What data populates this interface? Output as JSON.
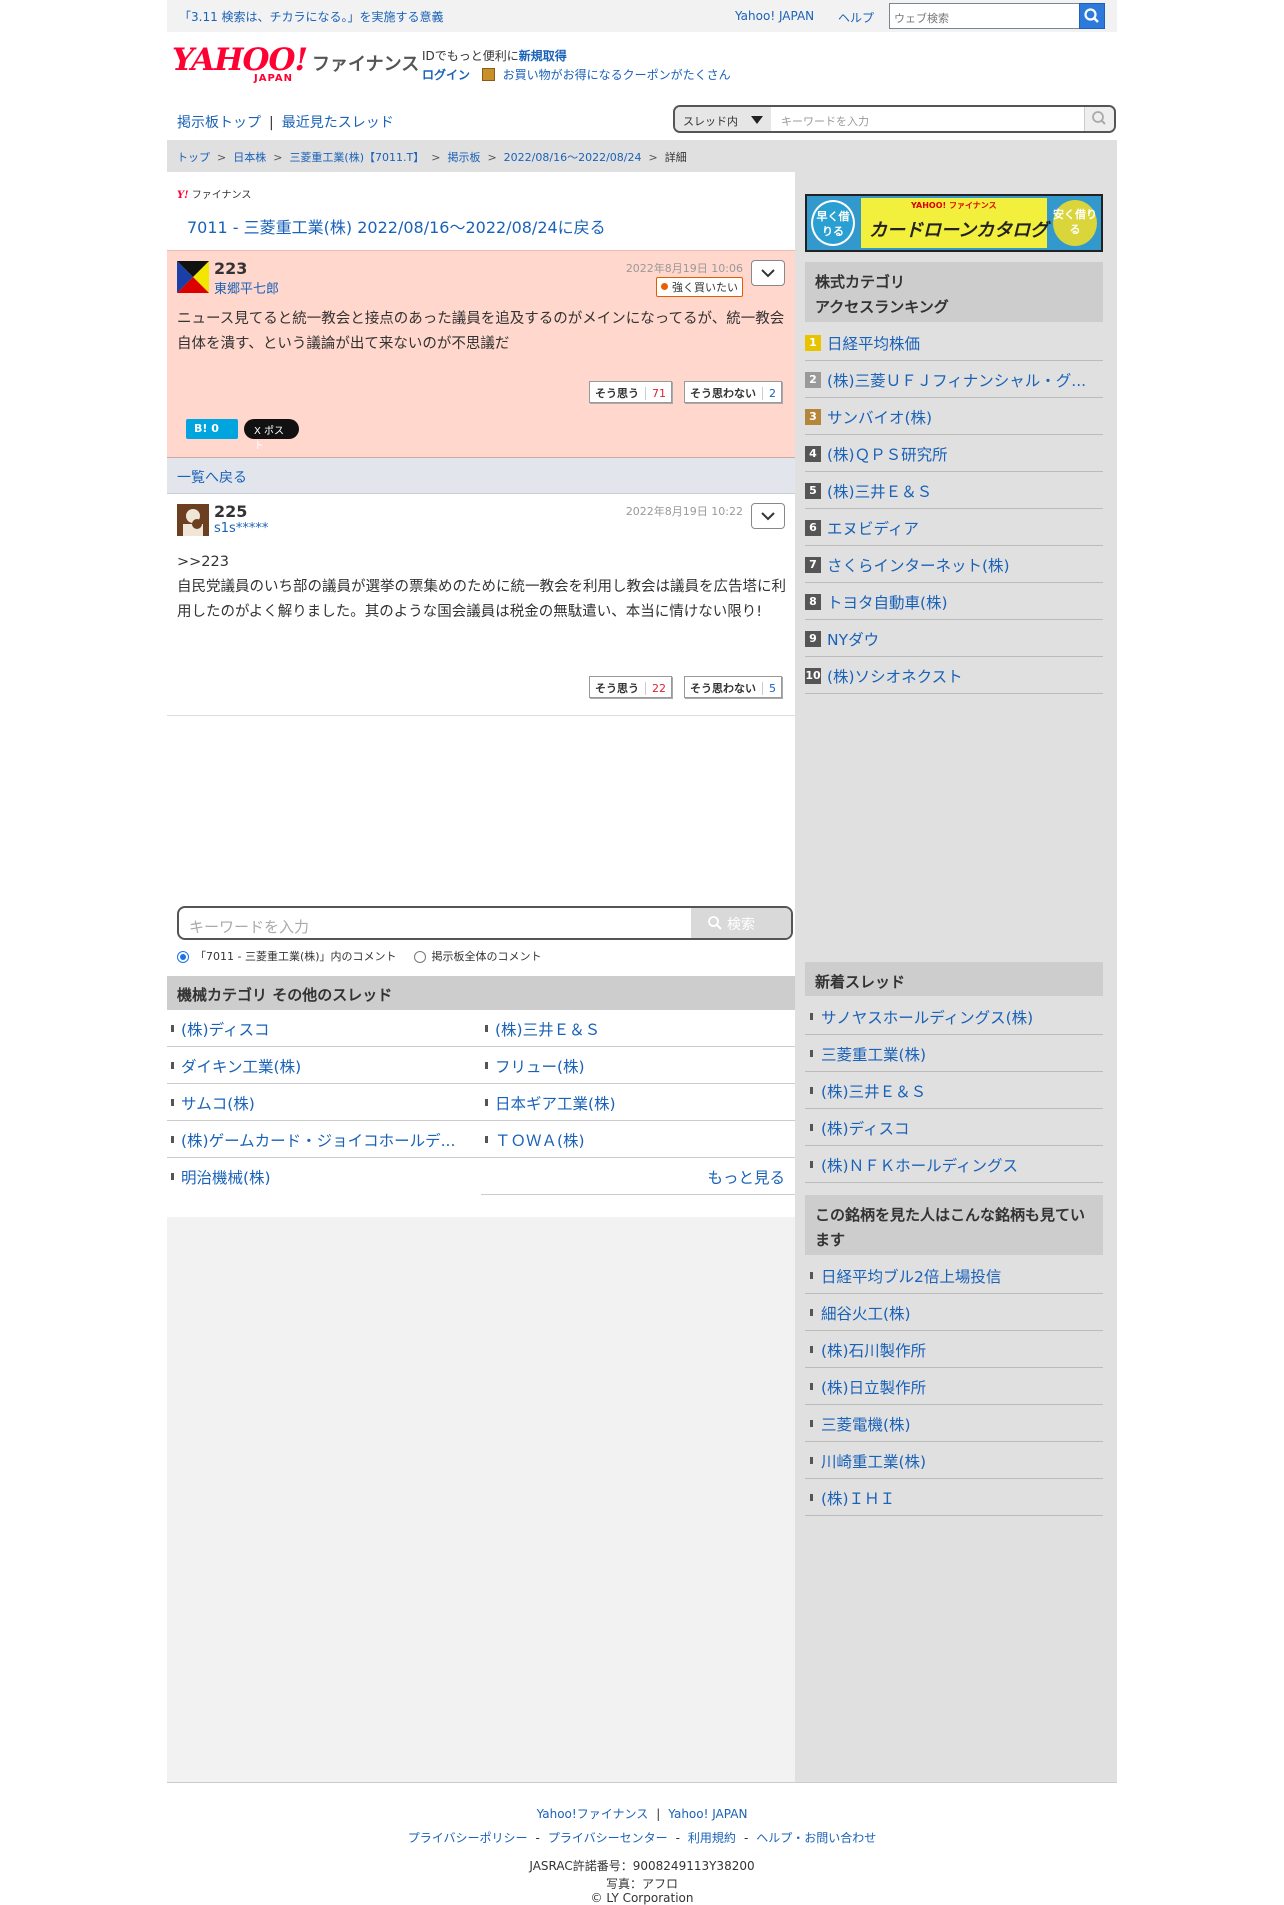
{
  "topbar": {
    "notice": "「3.11 検索は、チカラになる。」を実施する意義",
    "yahoo_japan": "Yahoo! JAPAN",
    "help": "ヘルプ",
    "web_search_placeholder": "ウェブ検索"
  },
  "logo": {
    "yahoo": "YAHOO!",
    "japan": "JAPAN",
    "service": "ファイナンス"
  },
  "id_area": {
    "line1_prefix": "IDでもっと便利に",
    "register": "新規取得",
    "login": "ログイン",
    "coupon": "お買い物がお得になるクーポンがたくさん"
  },
  "nav": {
    "board_top": "掲示板トップ",
    "recent_threads": "最近見たスレッド"
  },
  "thread_search": {
    "scope": "スレッド内",
    "placeholder": "キーワードを入力"
  },
  "breadcrumb": [
    "トップ",
    "日本株",
    "三菱重工業(株)【7011.T】",
    "掲示板",
    "2022/08/16〜2022/08/24",
    "詳細"
  ],
  "main": {
    "yf_brand": "ファイナンス",
    "back_link": "7011 - 三菱重工業(株) 2022/08/16〜2022/08/24に戻る",
    "back_to_list": "一覧へ戻る"
  },
  "posts": [
    {
      "number": "223",
      "author": "東郷平七郎",
      "date": "2022年8月19日 10:06",
      "sentiment": "強く買いたい",
      "text": "ニュース見てると統一教会と接点のあった議員を追及するのがメインになってるが、統一教会自体を潰す、という議論が出て来ないのが不思議だ",
      "agree_label": "そう思う",
      "agree_count": "71",
      "disagree_label": "そう思わない",
      "disagree_count": "2",
      "hatena": "B! 0",
      "tweet": "X ポスト"
    },
    {
      "number": "225",
      "author": "s1s*****",
      "date": "2022年8月19日 10:22",
      "text": ">>223\n自民党議員のいち部の議員が選挙の票集めのために統一教会を利用し教会は議員を広告塔に利用したのがよく解りました。其のような国会議員は税金の無駄遣い、本当に情けない限り!",
      "agree_label": "そう思う",
      "agree_count": "22",
      "disagree_label": "そう思わない",
      "disagree_count": "5"
    }
  ],
  "keyword_search": {
    "placeholder": "キーワードを入力",
    "button": "検索",
    "option_thread": "「7011 - 三菱重工業(株)」内のコメント",
    "option_all": "掲示板全体のコメント"
  },
  "other_threads": {
    "title": "機械カテゴリ その他のスレッド",
    "items": [
      "(株)ディスコ",
      "(株)三井Ｅ＆Ｓ",
      "ダイキン工業(株)",
      "フリュー(株)",
      "サムコ(株)",
      "日本ギア工業(株)",
      "(株)ゲームカード・ジョイコホールデ...",
      "ＴＯＷＡ(株)",
      "明治機械(株)"
    ],
    "more": "もっと見る"
  },
  "ad": {
    "left": "早く借りる",
    "brand": "YAHOO! ファイナンス",
    "title": "カードローンカタログ",
    "right": "安く借りる"
  },
  "ranking": {
    "title": "株式カテゴリ\nアクセスランキング",
    "items": [
      {
        "rank": "1",
        "name": "日経平均株価"
      },
      {
        "rank": "2",
        "name": "(株)三菱ＵＦＪフィナンシャル・グ..."
      },
      {
        "rank": "3",
        "name": "サンバイオ(株)"
      },
      {
        "rank": "4",
        "name": "(株)ＱＰＳ研究所"
      },
      {
        "rank": "5",
        "name": "(株)三井Ｅ＆Ｓ"
      },
      {
        "rank": "6",
        "name": "エヌビディア"
      },
      {
        "rank": "7",
        "name": "さくらインターネット(株)"
      },
      {
        "rank": "8",
        "name": "トヨタ自動車(株)"
      },
      {
        "rank": "9",
        "name": "NYダウ"
      },
      {
        "rank": "10",
        "name": "(株)ソシオネクスト"
      }
    ]
  },
  "new_threads": {
    "title": "新着スレッド",
    "items": [
      "サノヤスホールディングス(株)",
      "三菱重工業(株)",
      "(株)三井Ｅ＆Ｓ",
      "(株)ディスコ",
      "(株)ＮＦＫホールディングス"
    ]
  },
  "also_viewed": {
    "title": "この銘柄を見た人はこんな銘柄も見ています",
    "items": [
      "日経平均ブル2倍上場投信",
      "細谷火工(株)",
      "(株)石川製作所",
      "(株)日立製作所",
      "三菱電機(株)",
      "川崎重工業(株)",
      "(株)ＩＨＩ"
    ]
  },
  "footer": {
    "yf": "Yahoo!ファイナンス",
    "yj": "Yahoo! JAPAN",
    "privacy_policy": "プライバシーポリシー",
    "privacy_center": "プライバシーセンター",
    "terms": "利用規約",
    "help": "ヘルプ・お問い合わせ",
    "jasrac": "JASRAC許諾番号：9008249113Y38200",
    "photo": "写真：アフロ",
    "copyright": "© LY Corporation"
  },
  "colors": {
    "link": "#1a62b8",
    "post_highlight": "#ffd7cc",
    "brand_red": "#ff0033",
    "sentiment": "#ea5d00"
  }
}
